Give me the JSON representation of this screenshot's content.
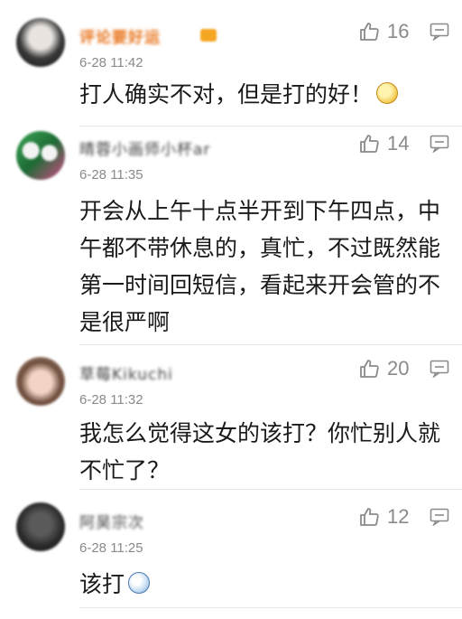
{
  "comments": [
    {
      "username": "评论要好运",
      "badge_color": "#f5a623",
      "time": "6-28 11:42",
      "likes": "16",
      "text": "打人确实不对，但是打的好！",
      "emoji": "doge-emoji"
    },
    {
      "username": "晴蓉小画师小杯ar",
      "time": "6-28 11:35",
      "likes": "14",
      "text": "开会从上午十点半开到下午四点，中午都不带休息的，真忙，不过既然能第一时间回短信，看起来开会管的不是很严啊"
    },
    {
      "username": "草莓Kikuchi",
      "time": "6-28 11:32",
      "likes": "20",
      "text": "我怎么觉得这女的该打？你忙别人就不忙了？"
    },
    {
      "username": "阿昊宗次",
      "time": "6-28 11:25",
      "likes": "12",
      "text": "该打",
      "emoji": "shocked-emoji"
    }
  ]
}
